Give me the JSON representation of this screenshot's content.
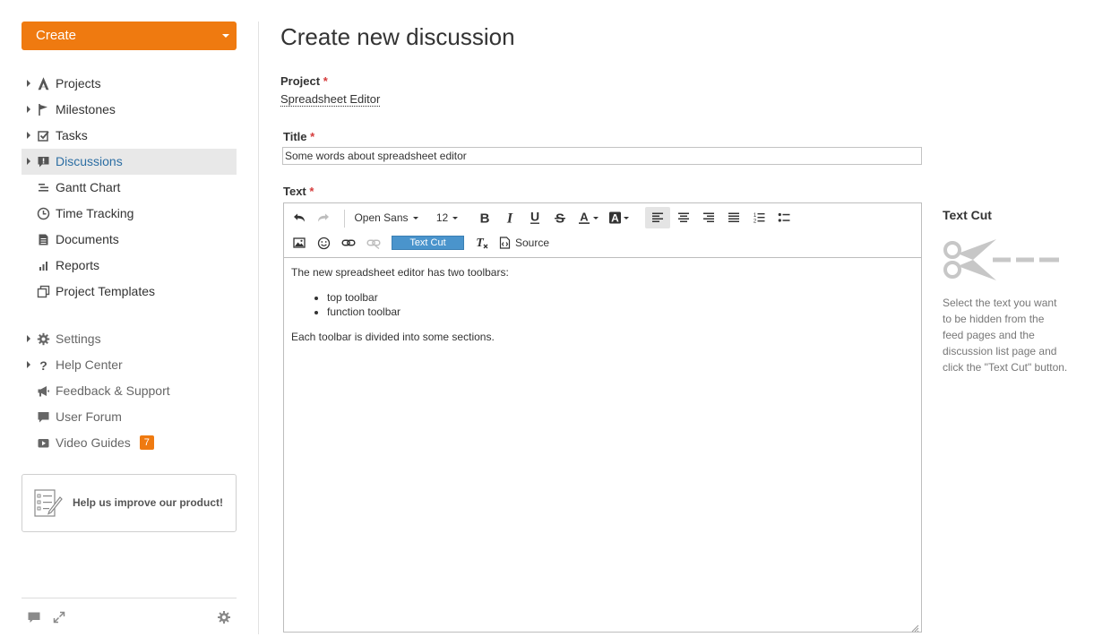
{
  "sidebar": {
    "create_label": "Create",
    "nav_main": [
      {
        "label": "Projects",
        "icon": "projects-icon",
        "expandable": true
      },
      {
        "label": "Milestones",
        "icon": "flag-icon",
        "expandable": true
      },
      {
        "label": "Tasks",
        "icon": "checkbox-icon",
        "expandable": true
      },
      {
        "label": "Discussions",
        "icon": "discussion-icon",
        "expandable": true,
        "active": true
      },
      {
        "label": "Gantt Chart",
        "icon": "gantt-icon",
        "expandable": false
      },
      {
        "label": "Time Tracking",
        "icon": "clock-icon",
        "expandable": false
      },
      {
        "label": "Documents",
        "icon": "document-icon",
        "expandable": false
      },
      {
        "label": "Reports",
        "icon": "chart-icon",
        "expandable": false
      },
      {
        "label": "Project Templates",
        "icon": "templates-icon",
        "expandable": false
      }
    ],
    "nav_secondary": [
      {
        "label": "Settings",
        "icon": "gear-icon",
        "expandable": true
      },
      {
        "label": "Help Center",
        "icon": "question-icon",
        "expandable": true
      },
      {
        "label": "Feedback & Support",
        "icon": "megaphone-icon",
        "expandable": false
      },
      {
        "label": "User Forum",
        "icon": "chat-icon",
        "expandable": false
      },
      {
        "label": "Video Guides",
        "icon": "video-icon",
        "expandable": false,
        "badge": "7"
      }
    ],
    "improve_label": "Help us improve our product!"
  },
  "main": {
    "page_title": "Create new discussion",
    "project_label": "Project",
    "project_value": "Spreadsheet Editor",
    "title_label": "Title",
    "title_value": "Some words about spreadsheet editor",
    "text_label": "Text",
    "required_mark": "*",
    "editor": {
      "font_name": "Open Sans",
      "font_size": "12",
      "text_cut_label": "Text Cut",
      "source_label": "Source",
      "content": {
        "intro": "The new spreadsheet editor has two toolbars:",
        "items": [
          "top toolbar",
          "function toolbar"
        ],
        "outro": "Each toolbar is divided into some sections."
      }
    }
  },
  "text_cut_panel": {
    "title": "Text Cut",
    "description": "Select the text you want to be hidden from the feed pages and the discussion list page and click the \"Text Cut\" button."
  },
  "colors": {
    "accent": "#ef7a10",
    "active_nav": "#2c6ea3",
    "text_cut_button": "#4a94cc",
    "required": "#d53b3b"
  }
}
